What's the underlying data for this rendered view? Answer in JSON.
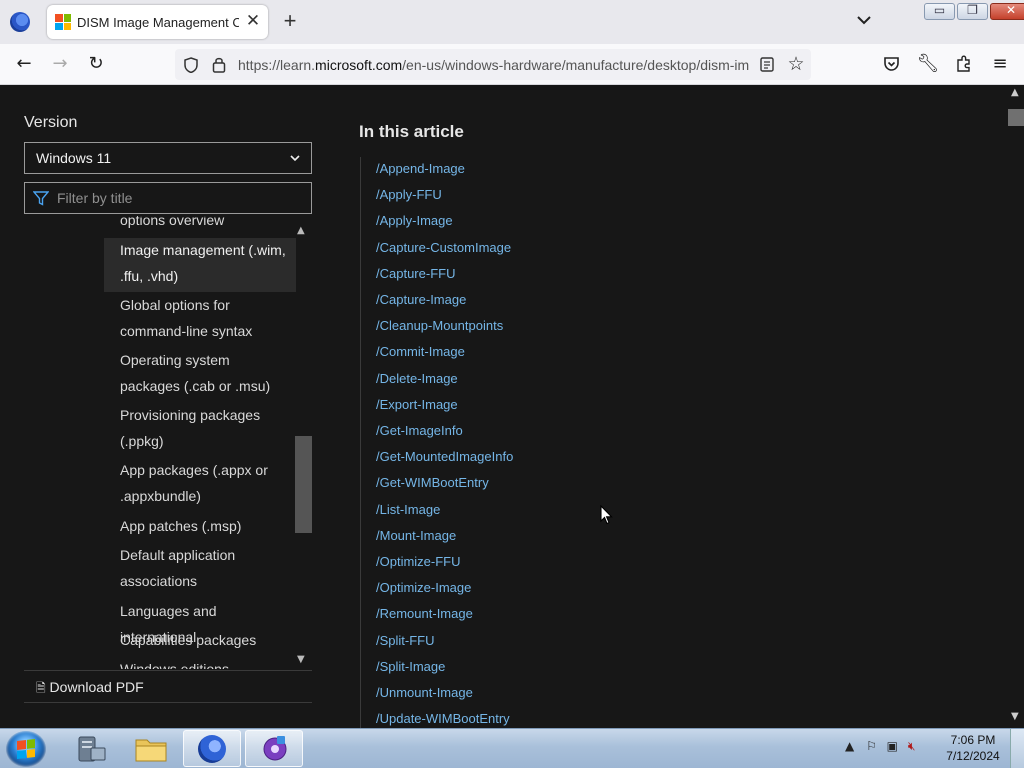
{
  "browser": {
    "tab_title": "DISM Image Management Con",
    "url_prefix": "https://learn.",
    "url_domain": "microsoft.com",
    "url_path": "/en-us/windows-hardware/manufacture/desktop/dism-im"
  },
  "sidebar": {
    "version_label": "Version",
    "version_selected": "Windows 11",
    "filter_placeholder": "Filter by title",
    "toc": [
      "options overview",
      "Image management (.wim, .ffu, .vhd)",
      "Global options for command-line syntax",
      "Operating system packages (.cab or .msu)",
      "Provisioning packages (.ppkg)",
      "App packages (.appx or .appxbundle)",
      "App patches (.msp)",
      "Default application associations",
      "Languages and international",
      "Capabilities packages",
      "Windows editions"
    ],
    "download_pdf": "Download PDF"
  },
  "article": {
    "heading": "In this article",
    "links": [
      "/Append-Image",
      "/Apply-FFU",
      "/Apply-Image",
      "/Capture-CustomImage",
      "/Capture-FFU",
      "/Capture-Image",
      "/Cleanup-Mountpoints",
      "/Commit-Image",
      "/Delete-Image",
      "/Export-Image",
      "/Get-ImageInfo",
      "/Get-MountedImageInfo",
      "/Get-WIMBootEntry",
      "/List-Image",
      "/Mount-Image",
      "/Optimize-FFU",
      "/Optimize-Image",
      "/Remount-Image",
      "/Split-FFU",
      "/Split-Image",
      "/Unmount-Image",
      "/Update-WIMBootEntry"
    ]
  },
  "taskbar": {
    "time": "7:06 PM",
    "date": "7/12/2024"
  },
  "colors": {
    "page_bg": "#171717",
    "link": "#75b6e7",
    "text": "#e6e6e6"
  }
}
